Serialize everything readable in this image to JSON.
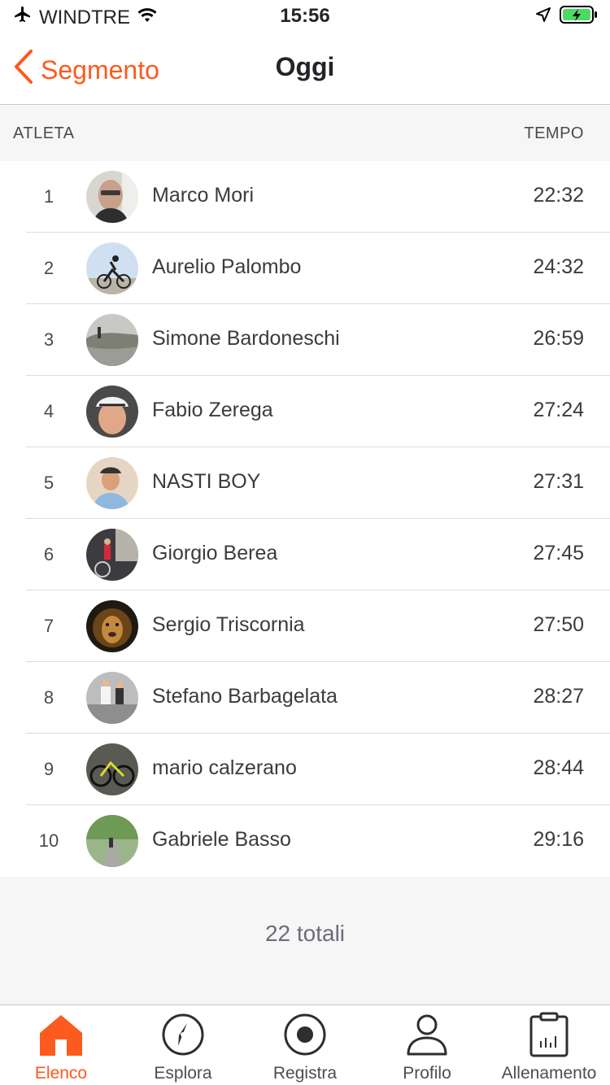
{
  "status_bar": {
    "carrier": "WINDTRE",
    "time": "15:56"
  },
  "navbar": {
    "back_label": "Segmento",
    "title": "Oggi"
  },
  "columns": {
    "athlete": "ATLETA",
    "time": "TEMPO"
  },
  "athletes": [
    {
      "rank": "1",
      "name": "Marco Mori",
      "time": "22:32"
    },
    {
      "rank": "2",
      "name": "Aurelio Palombo",
      "time": "24:32"
    },
    {
      "rank": "3",
      "name": "Simone Bardoneschi",
      "time": "26:59"
    },
    {
      "rank": "4",
      "name": "Fabio Zerega",
      "time": "27:24"
    },
    {
      "rank": "5",
      "name": "NASTI BOY",
      "time": "27:31"
    },
    {
      "rank": "6",
      "name": "Giorgio Berea",
      "time": "27:45"
    },
    {
      "rank": "7",
      "name": "Sergio Triscornia",
      "time": "27:50"
    },
    {
      "rank": "8",
      "name": "Stefano Barbagelata",
      "time": "28:27"
    },
    {
      "rank": "9",
      "name": "mario calzerano",
      "time": "28:44"
    },
    {
      "rank": "10",
      "name": "Gabriele Basso",
      "time": "29:16"
    }
  ],
  "total_label": "22 totali",
  "tabs": [
    {
      "label": "Elenco",
      "icon": "home-icon",
      "active": true
    },
    {
      "label": "Esplora",
      "icon": "compass-icon",
      "active": false
    },
    {
      "label": "Registra",
      "icon": "record-icon",
      "active": false
    },
    {
      "label": "Profilo",
      "icon": "profile-icon",
      "active": false
    },
    {
      "label": "Allenamento",
      "icon": "training-icon",
      "active": false
    }
  ],
  "colors": {
    "accent": "#fc5a1e",
    "battery": "#4cd964"
  }
}
